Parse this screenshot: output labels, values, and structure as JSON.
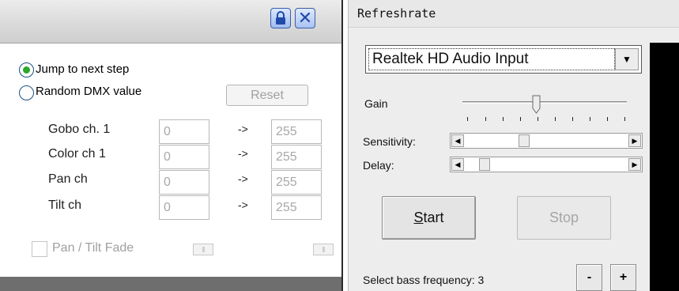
{
  "left_panel": {
    "title_buttons": {
      "lock_icon": "lock-icon",
      "close_icon": "close-icon",
      "close_glyph": "✕"
    },
    "radios": [
      {
        "label": "Jump to next step",
        "checked": true
      },
      {
        "label": "Random DMX value",
        "checked": false
      }
    ],
    "reset_label": "Reset",
    "channels": [
      {
        "label": "Gobo ch. 1",
        "from": "0",
        "arrow": "->",
        "to": "255"
      },
      {
        "label": "Color ch 1",
        "from": "0",
        "arrow": "->",
        "to": "255"
      },
      {
        "label": "Pan ch",
        "from": "0",
        "arrow": "->",
        "to": "255"
      },
      {
        "label": "Tilt ch",
        "from": "0",
        "arrow": "->",
        "to": "255"
      }
    ],
    "pan_tilt_fade_label": "Pan / Tilt Fade"
  },
  "right_panel": {
    "title": "Refreshrate",
    "device_select": {
      "value": "Realtek HD Audio Input",
      "arrow_glyph": "▼"
    },
    "gain_label": "Gain",
    "sensitivity_label": "Sensitivity:",
    "delay_label": "Delay:",
    "start_label_first": "S",
    "start_label_rest": "tart",
    "stop_label": "Stop",
    "bass_label": "Select bass frequency: 3",
    "minus_label": "-",
    "plus_label": "+",
    "scroll_left_glyph": "◀",
    "scroll_right_glyph": "▶"
  }
}
